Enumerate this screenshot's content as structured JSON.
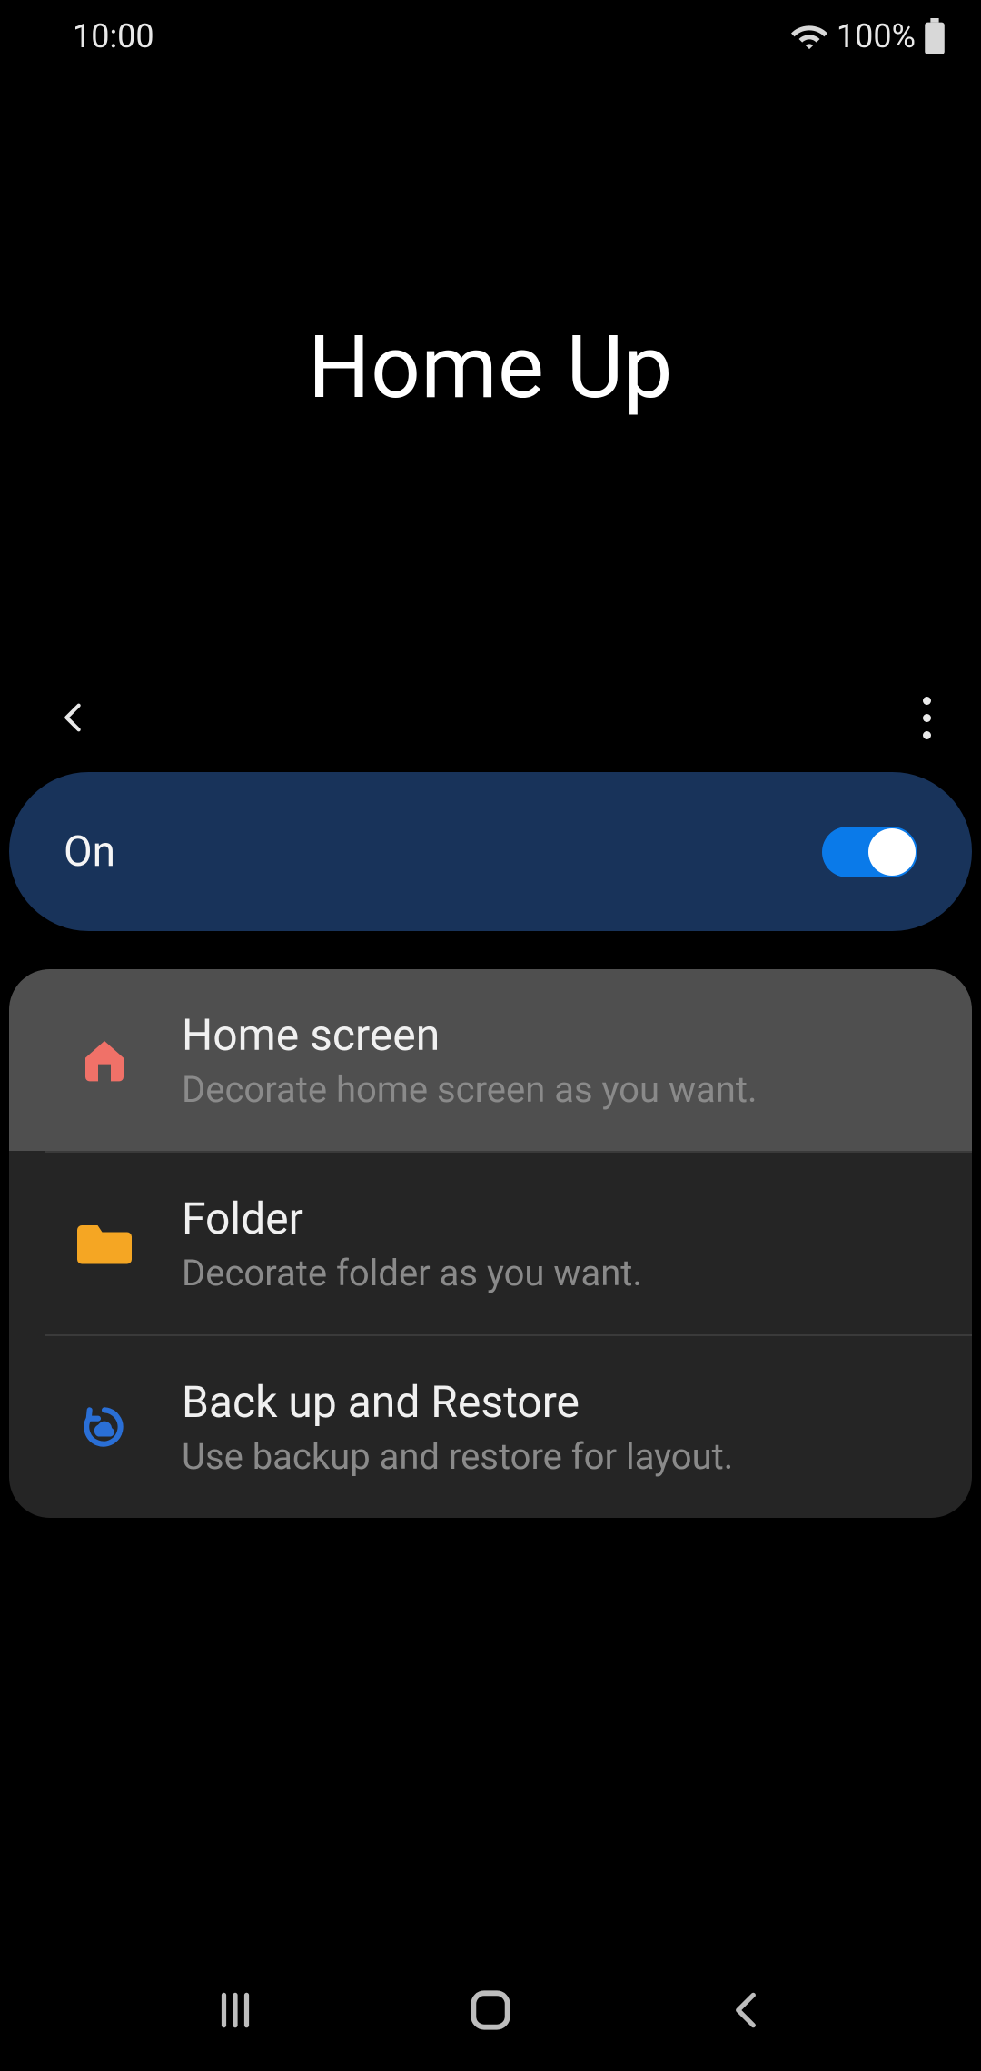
{
  "status": {
    "time": "10:00",
    "battery": "100%"
  },
  "page": {
    "title": "Home Up"
  },
  "toggle": {
    "label": "On",
    "state": true
  },
  "items": [
    {
      "title": "Home screen",
      "desc": "Decorate home screen as you want.",
      "icon": "home-icon",
      "highlight": true
    },
    {
      "title": "Folder",
      "desc": "Decorate folder as you want.",
      "icon": "folder-icon",
      "highlight": false
    },
    {
      "title": "Back up and Restore",
      "desc": "Use backup and restore for layout.",
      "icon": "backup-icon",
      "highlight": false
    }
  ]
}
